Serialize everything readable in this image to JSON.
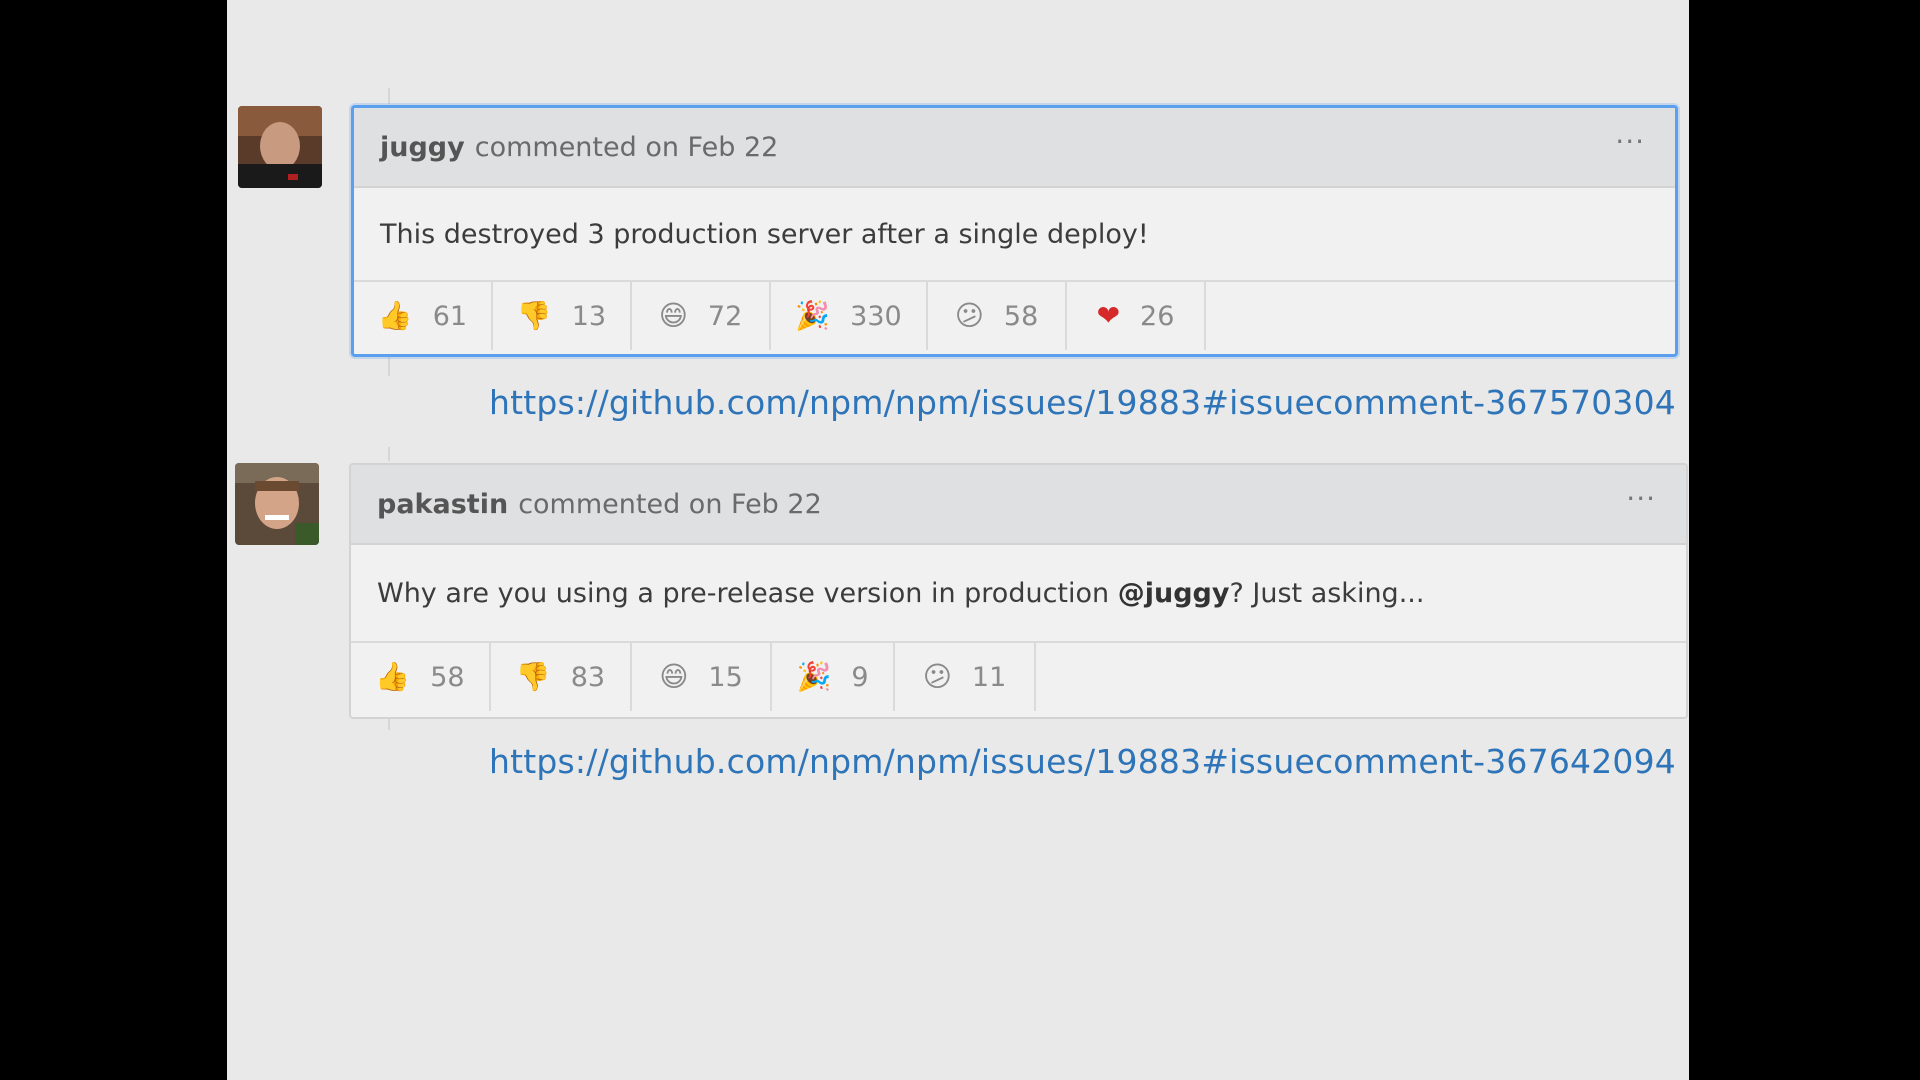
{
  "comments": [
    {
      "author": "juggy",
      "meta": "commented on Feb 22",
      "body": "This destroyed 3 production server after a single deploy!",
      "more_icon": "more-horizontal-icon",
      "reactions": [
        {
          "icon": "thumbs-up-icon",
          "emoji": "👍",
          "count": "61"
        },
        {
          "icon": "thumbs-down-icon",
          "emoji": "👎",
          "count": "13"
        },
        {
          "icon": "laugh-icon",
          "emoji": "😄",
          "count": "72"
        },
        {
          "icon": "hooray-icon",
          "emoji": "🎉",
          "count": "330"
        },
        {
          "icon": "confused-icon",
          "emoji": "😕",
          "count": "58"
        },
        {
          "icon": "heart-icon",
          "emoji": "❤",
          "count": "26"
        }
      ],
      "link": "https://github.com/npm/npm/issues/19883#issuecomment-367570304"
    },
    {
      "author": "pakastin",
      "meta": "commented on Feb 22",
      "body_before": "Why are you using a pre-release version in production ",
      "mention": "@juggy",
      "body_after": "? Just asking...",
      "more_icon": "more-horizontal-icon",
      "reactions": [
        {
          "icon": "thumbs-up-icon",
          "emoji": "👍",
          "count": "58"
        },
        {
          "icon": "thumbs-down-icon",
          "emoji": "👎",
          "count": "83"
        },
        {
          "icon": "laugh-icon",
          "emoji": "😄",
          "count": "15"
        },
        {
          "icon": "hooray-icon",
          "emoji": "🎉",
          "count": "9"
        },
        {
          "icon": "confused-icon",
          "emoji": "😕",
          "count": "11"
        }
      ],
      "link": "https://github.com/npm/npm/issues/19883#issuecomment-367642094"
    }
  ],
  "colors": {
    "link": "#2e74b8",
    "focus_border": "#5aa0ef",
    "heart": "#d62a2a"
  }
}
